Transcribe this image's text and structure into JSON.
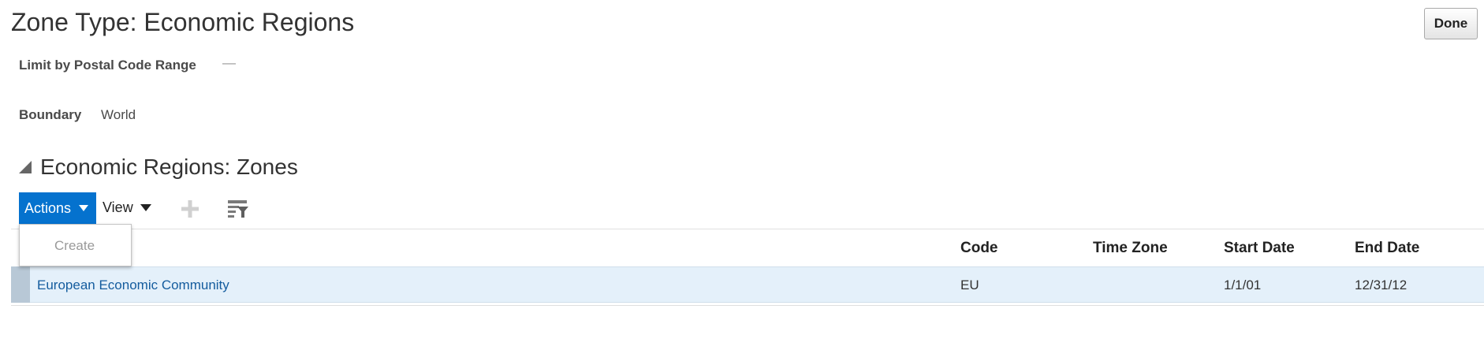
{
  "header": {
    "title": "Zone Type: Economic Regions",
    "done_label": "Done"
  },
  "fields": {
    "limit_label": "Limit by Postal Code Range",
    "limit_value": "—",
    "boundary_label": "Boundary",
    "boundary_value": "World"
  },
  "section": {
    "title": "Economic Regions: Zones",
    "collapse_icon": "disclosure-triangle-icon"
  },
  "toolbar": {
    "actions_label": "Actions",
    "view_label": "View",
    "add_icon": "plus-icon",
    "filter_icon": "query-by-example-icon"
  },
  "actions_menu": {
    "items": [
      "Create"
    ]
  },
  "table": {
    "columns": [
      "Code",
      "Time Zone",
      "Start Date",
      "End Date"
    ],
    "rows": [
      {
        "name": "European Economic Community",
        "code": "EU",
        "time_zone": "",
        "start_date": "1/1/01",
        "end_date": "12/31/12"
      }
    ]
  },
  "colors": {
    "accent": "#0572ce",
    "selected_row": "#e4f0fa",
    "link": "#145c9e"
  }
}
